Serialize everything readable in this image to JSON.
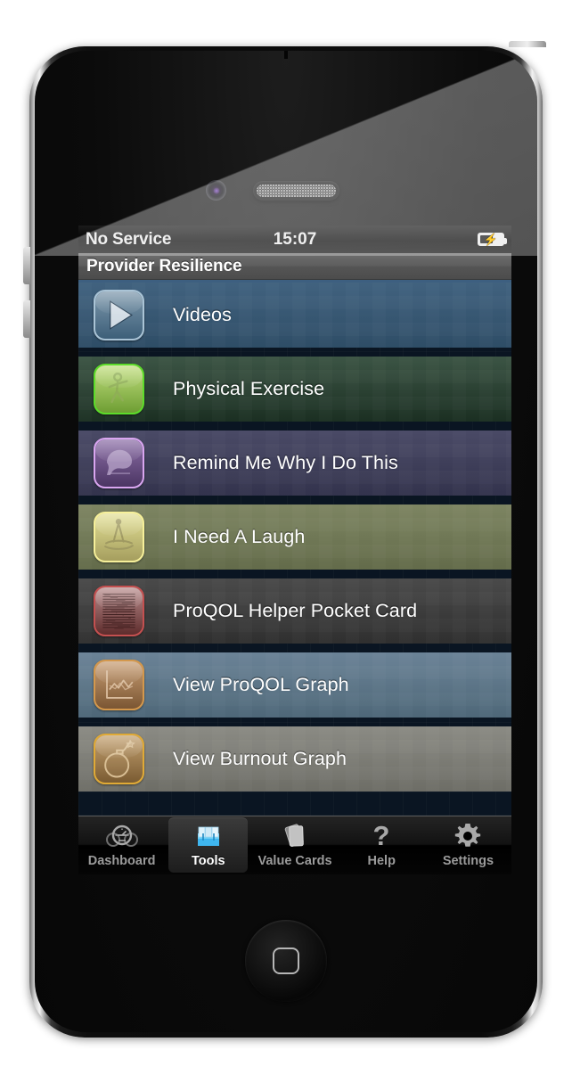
{
  "device": {
    "name": "iphone-4",
    "camera": "front-camera",
    "speaker": "earpiece-speaker",
    "home_button": "home-button"
  },
  "status_bar": {
    "carrier": "No Service",
    "clock": "15:07",
    "battery_icon": "battery-charging-icon",
    "battery_glyph": "⚡"
  },
  "nav_bar": {
    "title": "Provider Resilience"
  },
  "colors": {
    "list_background": "#0a1522",
    "nav_bar": "#5a5a5a",
    "separator": "#3d5f80",
    "selected_tab_text": "#ffffff",
    "tab_text": "#9b9b9b"
  },
  "list": {
    "rows": [
      {
        "label": "Videos",
        "icon": "play-triangle-icon",
        "row_color_top": "#41627f",
        "row_color_bottom": "#2e4d66",
        "icon_color_top": "#7d98ac",
        "icon_color_bottom": "#3d5f79",
        "icon_border": "#aac4d6",
        "glyph_color": "#e9eff4"
      },
      {
        "label": "Physical Exercise",
        "icon": "running-figure-icon",
        "row_color_top": "#3c5545",
        "row_color_bottom": "#1b2f22",
        "icon_color_top": "#c1de7e",
        "icon_color_bottom": "#6e9e33",
        "icon_border": "#5cdc2a",
        "glyph_color": "#8fae56"
      },
      {
        "label": "Remind Me Why I Do This",
        "icon": "bird-icon",
        "row_color_top": "#4a4a66",
        "row_color_bottom": "#33334d",
        "icon_color_top": "#8d6fa8",
        "icon_color_bottom": "#4b3563",
        "icon_border": "#d9a6f0",
        "glyph_color": "#b9a5cb"
      },
      {
        "label": "I Need A Laugh",
        "icon": "jester-hat-icon",
        "row_color_top": "#7d8562",
        "row_color_bottom": "#636b4a",
        "icon_color_top": "#e3e096",
        "icon_color_bottom": "#a59e5e",
        "icon_border": "#f6f09a",
        "glyph_color": "#a09a62"
      },
      {
        "label": "ProQOL Helper Pocket Card",
        "icon": "text-card-icon",
        "row_color_top": "#4a4a4a",
        "row_color_bottom": "#2f2f2f",
        "icon_color_top": "#b98d8d",
        "icon_color_bottom": "#5e2c2c",
        "icon_border": "#c45050",
        "glyph_color": "#3a1c1c"
      },
      {
        "label": "View ProQOL Graph",
        "icon": "line-chart-icon",
        "row_color_top": "#6b8397",
        "row_color_bottom": "#4e6778",
        "icon_color_top": "#c89e74",
        "icon_color_bottom": "#7b5633",
        "icon_border": "#d4984c",
        "glyph_color": "#d8bb9c"
      },
      {
        "label": "View Burnout Graph",
        "icon": "bomb-icon",
        "row_color_top": "#8b8b84",
        "row_color_bottom": "#6d6d66",
        "icon_color_top": "#c4a271",
        "icon_color_bottom": "#7a5b32",
        "icon_border": "#e0aa36",
        "glyph_color": "#d9bf95"
      }
    ]
  },
  "tab_bar": {
    "items": [
      {
        "label": "Dashboard",
        "icon": "gauges-icon",
        "selected": false
      },
      {
        "label": "Tools",
        "icon": "toolbox-icon",
        "selected": true
      },
      {
        "label": "Value Cards",
        "icon": "cards-icon",
        "selected": false
      },
      {
        "label": "Help",
        "icon": "question-mark-icon",
        "selected": false
      },
      {
        "label": "Settings",
        "icon": "gear-icon",
        "selected": false
      }
    ]
  }
}
